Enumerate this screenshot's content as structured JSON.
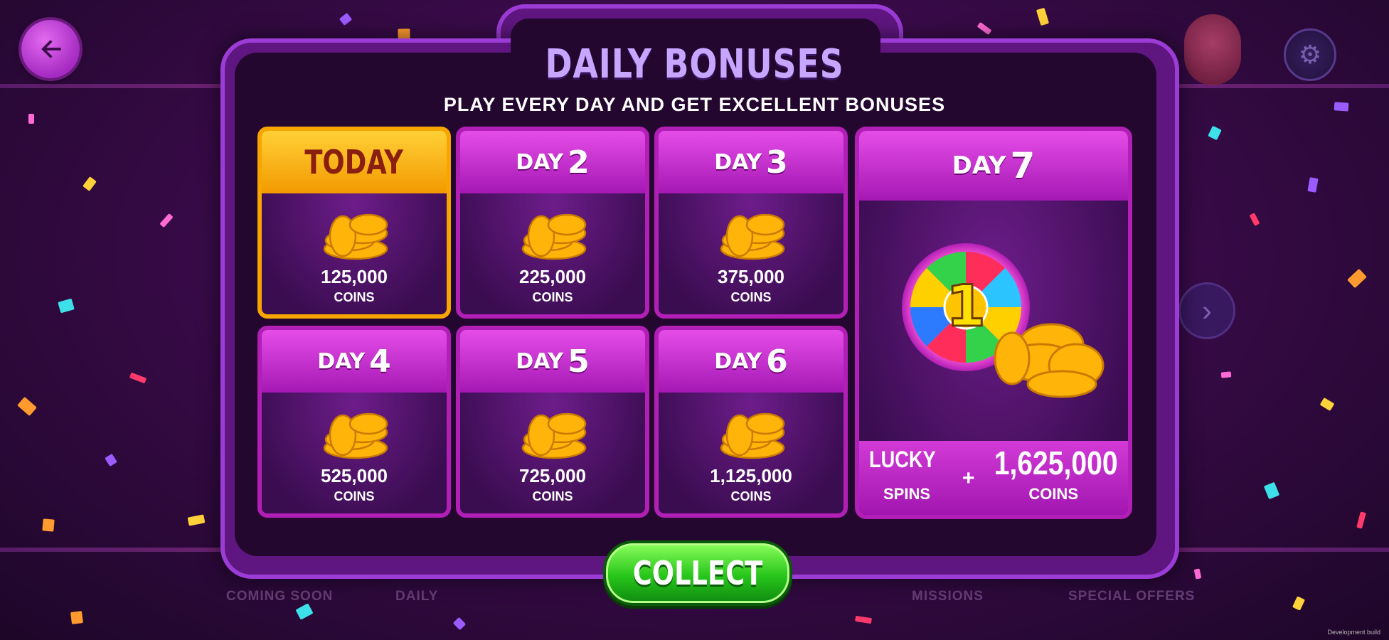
{
  "header": {
    "title": "DAILY BONUSES",
    "subtitle": "PLAY EVERY DAY AND GET EXCELLENT BONUSES"
  },
  "days": [
    {
      "label": "TODAY",
      "num": "",
      "amount": "125,000",
      "unit": "COINS",
      "state": "today"
    },
    {
      "label": "DAY",
      "num": "2",
      "amount": "225,000",
      "unit": "COINS",
      "state": "locked"
    },
    {
      "label": "DAY",
      "num": "3",
      "amount": "375,000",
      "unit": "COINS",
      "state": "locked"
    },
    {
      "label": "DAY",
      "num": "4",
      "amount": "525,000",
      "unit": "COINS",
      "state": "locked"
    },
    {
      "label": "DAY",
      "num": "5",
      "amount": "725,000",
      "unit": "COINS",
      "state": "locked"
    },
    {
      "label": "DAY",
      "num": "6",
      "amount": "1,125,000",
      "unit": "COINS",
      "state": "locked"
    }
  ],
  "day7": {
    "label": "DAY",
    "num": "7",
    "wheel_number": "1",
    "lucky": "LUCKY",
    "spins": "SPINS",
    "plus": "+",
    "amount": "1,625,000",
    "unit": "COINS"
  },
  "collect_label": "COLLECT",
  "bottom_nav": [
    "COMING SOON",
    "DAILY",
    "MISSIONS",
    "SPECIAL OFFERS"
  ],
  "watermark": "Development build",
  "colors": {
    "panel_border": "#9c3cd6",
    "card_border": "#b21fb6",
    "today_accent": "#f7a600",
    "collect_green": "#27c51a",
    "title_lilac": "#c7a6ff"
  },
  "icons": {
    "back": "arrow-left-icon",
    "settings": "gear-icon",
    "next": "chevron-right-icon",
    "coins": "coin-stack-icon",
    "wheel": "prize-wheel-icon"
  }
}
